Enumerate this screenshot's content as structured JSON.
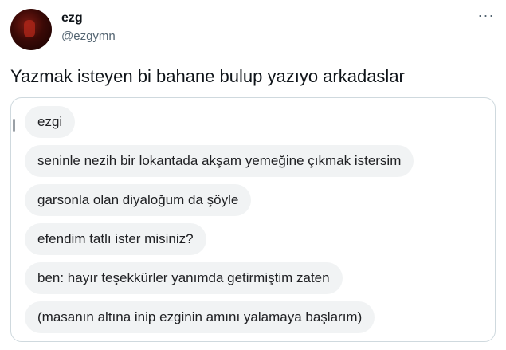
{
  "tweet": {
    "author": {
      "display_name": "ezg",
      "handle": "@ezgymn"
    },
    "more_icon": "more-horizontal-icon",
    "text": "Yazmak isteyen bi bahane bulup yazıyo arkadaslar"
  },
  "media": {
    "messages": [
      "ezgi",
      "seninle nezih bir lokantada akşam yemeğine çıkmak istersim",
      "garsonla olan diyaloğum da şöyle",
      "efendim tatlı ister misiniz?",
      "ben: hayır teşekkürler yanımda getirmiştim zaten",
      "(masanın altına inip ezginin amını yalamaya başlarım)"
    ]
  }
}
